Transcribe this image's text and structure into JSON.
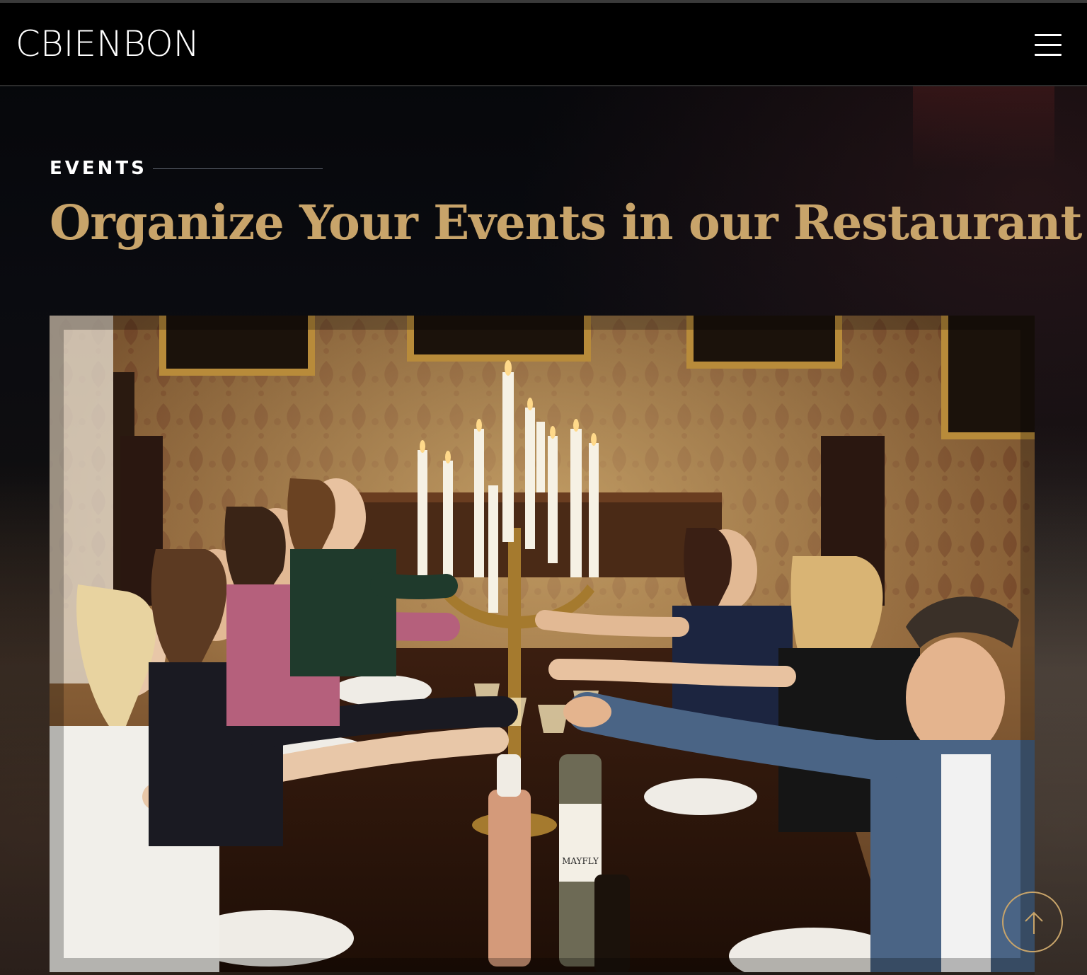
{
  "header": {
    "logo": "CBIENBON",
    "menu_icon": "hamburger-menu-icon"
  },
  "section": {
    "eyebrow": "EVENTS",
    "title": "Organize Your Events in our Restaurant"
  },
  "image": {
    "description_icon": "dinner-party-photo",
    "visible_label": "MAYFLY"
  },
  "scroll_top": {
    "icon": "arrow-up-icon"
  },
  "colors": {
    "accent": "#c8a46a",
    "header_bg": "#000000",
    "page_bg": "#07080d",
    "text": "#ffffff"
  }
}
